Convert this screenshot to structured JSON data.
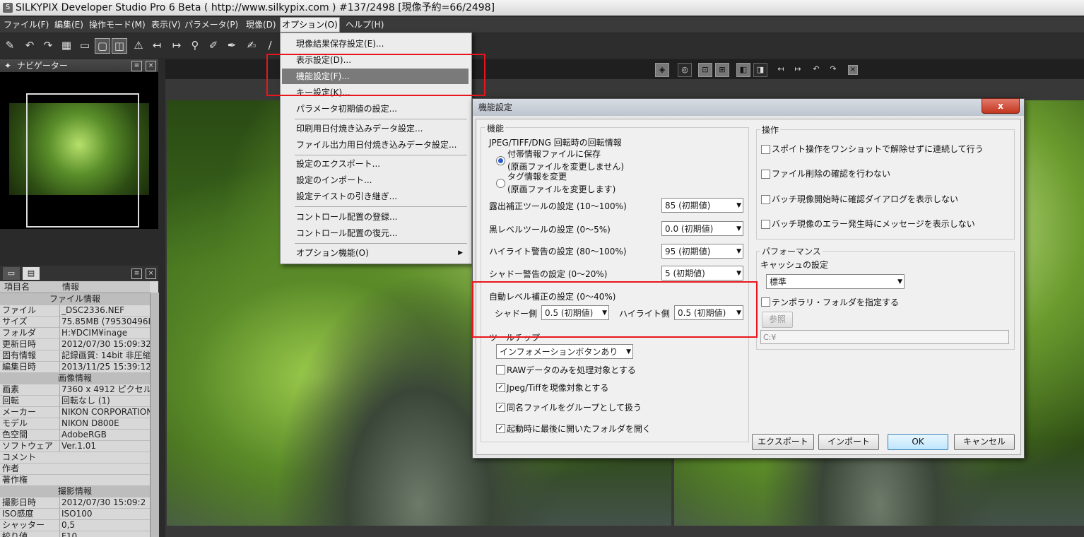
{
  "window": {
    "title": "SILKYPIX Developer Studio Pro 6 Beta ( http://www.silkypix.com )  #137/2498 [現像予約=66/2498]"
  },
  "menubar": [
    {
      "label": "ファイル(F)"
    },
    {
      "label": "編集(E)"
    },
    {
      "label": "操作モード(M)"
    },
    {
      "label": "表示(V)"
    },
    {
      "label": "パラメータ(P)"
    },
    {
      "label": "現像(D)"
    },
    {
      "label": "オプション(O)"
    },
    {
      "label": "ヘルプ(H)"
    }
  ],
  "navigator": {
    "title": "ナビゲーター"
  },
  "info": {
    "col_key": "項目名",
    "col_value": "情報",
    "rows": [
      {
        "section": "ファイル情報"
      },
      {
        "k": "ファイル",
        "v": "_DSC2336.NEF"
      },
      {
        "k": "サイズ",
        "v": "75.85MB (79530496By"
      },
      {
        "k": "フォルダ",
        "v": "H:¥DCIM¥inage"
      },
      {
        "k": "更新日時",
        "v": "2012/07/30 15:09:32"
      },
      {
        "k": "固有情報",
        "v": "記録画質: 14bit 非圧縮"
      },
      {
        "k": "編集日時",
        "v": "2013/11/25 15:39:12"
      },
      {
        "section": "画像情報"
      },
      {
        "k": "画素",
        "v": "7360 x 4912 ピクセル"
      },
      {
        "k": "回転",
        "v": "回転なし (1)"
      },
      {
        "k": "メーカー",
        "v": "NIKON CORPORATION"
      },
      {
        "k": "モデル",
        "v": "NIKON D800E"
      },
      {
        "k": "色空間",
        "v": "AdobeRGB"
      },
      {
        "k": "ソフトウェア",
        "v": "Ver.1.01"
      },
      {
        "k": "コメント",
        "v": ""
      },
      {
        "k": "作者",
        "v": ""
      },
      {
        "k": "著作権",
        "v": ""
      },
      {
        "section": "撮影情報"
      },
      {
        "k": "撮影日時",
        "v": "2012/07/30 15:09:2"
      },
      {
        "k": "ISO感度",
        "v": "ISO100"
      },
      {
        "k": "シャッター",
        "v": "0,5"
      },
      {
        "k": "絞り値",
        "v": "F10"
      }
    ]
  },
  "options_menu": {
    "items": [
      {
        "label": "現像結果保存設定(E)..."
      },
      {
        "label": "表示設定(D)..."
      },
      {
        "label": "機能設定(F)..."
      },
      {
        "label": "キー設定(K)..."
      },
      {
        "label": "パラメータ初期値の設定..."
      },
      {
        "label": "印刷用日付焼き込みデータ設定..."
      },
      {
        "label": "ファイル出力用日付焼き込みデータ設定..."
      },
      {
        "label": "設定のエクスポート..."
      },
      {
        "label": "設定のインポート..."
      },
      {
        "label": "設定テイストの引き継ぎ..."
      },
      {
        "label": "コントロール配置の登録..."
      },
      {
        "label": "コントロール配置の復元..."
      },
      {
        "label": "オプション機能(O)"
      }
    ]
  },
  "dialog": {
    "title": "機能設定",
    "close_label": "x",
    "func": {
      "group": "機能",
      "rotation_label": "JPEG/TIFF/DNG 回転時の回転情報",
      "radio1": "付帯情報ファイルに保存",
      "radio1_sub": "(原画ファイルを変更しません)",
      "radio2": "タグ情報を変更",
      "radio2_sub": "(原画ファイルを変更します)",
      "exposure_label": "露出補正ツールの設定 (10～100%)",
      "exposure_value": "85 (初期値)",
      "black_label": "黒レベルツールの設定 (0～5%)",
      "black_value": "0.0 (初期値)",
      "highlight_label": "ハイライト警告の設定 (80～100%)",
      "highlight_value": "95 (初期値)",
      "shadow_label": "シャドー警告の設定 (0～20%)",
      "shadow_value": "5 (初期値)",
      "autolevel_label": "自動レベル補正の設定 (0～40%)",
      "auto_shadow_label": "シャドー側",
      "auto_shadow_value": "0.5 (初期値)",
      "auto_highlight_label": "ハイライト側",
      "auto_highlight_value": "0.5 (初期値)",
      "tooltip_label": "ツールチップ",
      "tooltip_value": "インフォメーションボタンあり",
      "chk_raw": "RAWデータのみを処理対象とする",
      "chk_jpeg": "Jpeg/Tiffを現像対象とする",
      "chk_group": "同名ファイルをグループとして扱う",
      "chk_lastfolder": "起動時に最後に開いたフォルダを開く"
    },
    "ops": {
      "group": "操作",
      "chk1": "スポイト操作をワンショットで解除せずに連続して行う",
      "chk2": "ファイル削除の確認を行わない",
      "chk3": "バッチ現像開始時に確認ダイアログを表示しない",
      "chk4": "バッチ現像のエラー発生時にメッセージを表示しない"
    },
    "perf": {
      "group": "パフォーマンス",
      "cache_label": "キャッシュの設定",
      "cache_value": "標準",
      "temp_chk": "テンポラリ・フォルダを指定する",
      "browse": "参照",
      "path": "C:¥"
    },
    "buttons": {
      "export": "エクスポート",
      "import": "インポート",
      "ok": "OK",
      "cancel": "キャンセル"
    }
  },
  "checkmark": "✓",
  "colors": {
    "highlight_red": "#e8161c",
    "menu_highlight": "#7a7a7a"
  }
}
